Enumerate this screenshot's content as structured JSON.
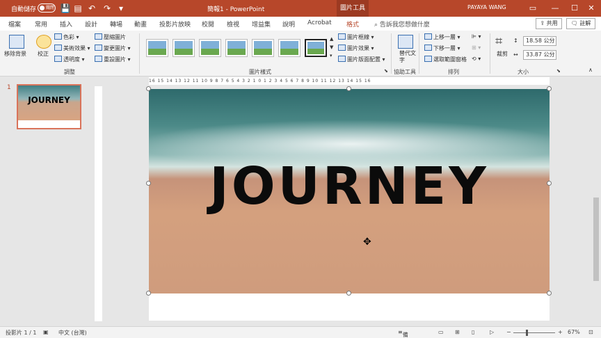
{
  "titlebar": {
    "autosave_label": "自動儲存",
    "autosave_state": "關閉",
    "doc_title": "簡報1 - PowerPoint",
    "context_tab": "圖片工具",
    "user": "PAYAYA WANG",
    "qat_save_icon": "save-icon",
    "qat_undo_icon": "undo-icon",
    "qat_redo_icon": "redo-icon",
    "minimize": "—",
    "maximize": "☐",
    "close": "✕",
    "restore": "▭"
  },
  "tabs": [
    "檔案",
    "常用",
    "插入",
    "設計",
    "轉場",
    "動畫",
    "投影片放映",
    "校閱",
    "檢視",
    "增益集",
    "說明",
    "Acrobat",
    "格式"
  ],
  "active_tab": "格式",
  "search_placeholder": "告訴我您想做什麼",
  "share_label": "共用",
  "comment_label": "註解",
  "ribbon": {
    "remove_bg": "移除背景",
    "corrections": "校正",
    "color": "色彩",
    "artistic": "美術效果",
    "transparency": "透明度",
    "compress": "壓縮圖片",
    "change": "變更圖片",
    "reset": "重設圖片",
    "group_adjust": "調整",
    "group_styles": "圖片樣式",
    "border": "圖片框線",
    "effects": "圖片效果",
    "layout": "圖片版面配置",
    "alt_text": "替代文字",
    "group_access": "協助工具",
    "bring_forward": "上移一層",
    "send_backward": "下移一層",
    "selection_pane": "選取範圍窗格",
    "group_arrange": "排列",
    "crop": "裁剪",
    "height": "18.58 公分",
    "width": "33.87 公分",
    "group_size": "大小"
  },
  "slides_pane": {
    "number": "1",
    "thumb_text": "JOURNEY"
  },
  "ruler_h": "16 15 14 13 12 11 10 9 8 7 6 5 4 3 2 1 0 1 2 3 4 5 6 7 8 9 10 11 12 13 14 15 16",
  "slide": {
    "title": "JOURNEY"
  },
  "status": {
    "slide_info": "投影片 1 / 1",
    "language": "中文 (台灣)",
    "notes": "備忘稿",
    "zoom": "67%"
  }
}
